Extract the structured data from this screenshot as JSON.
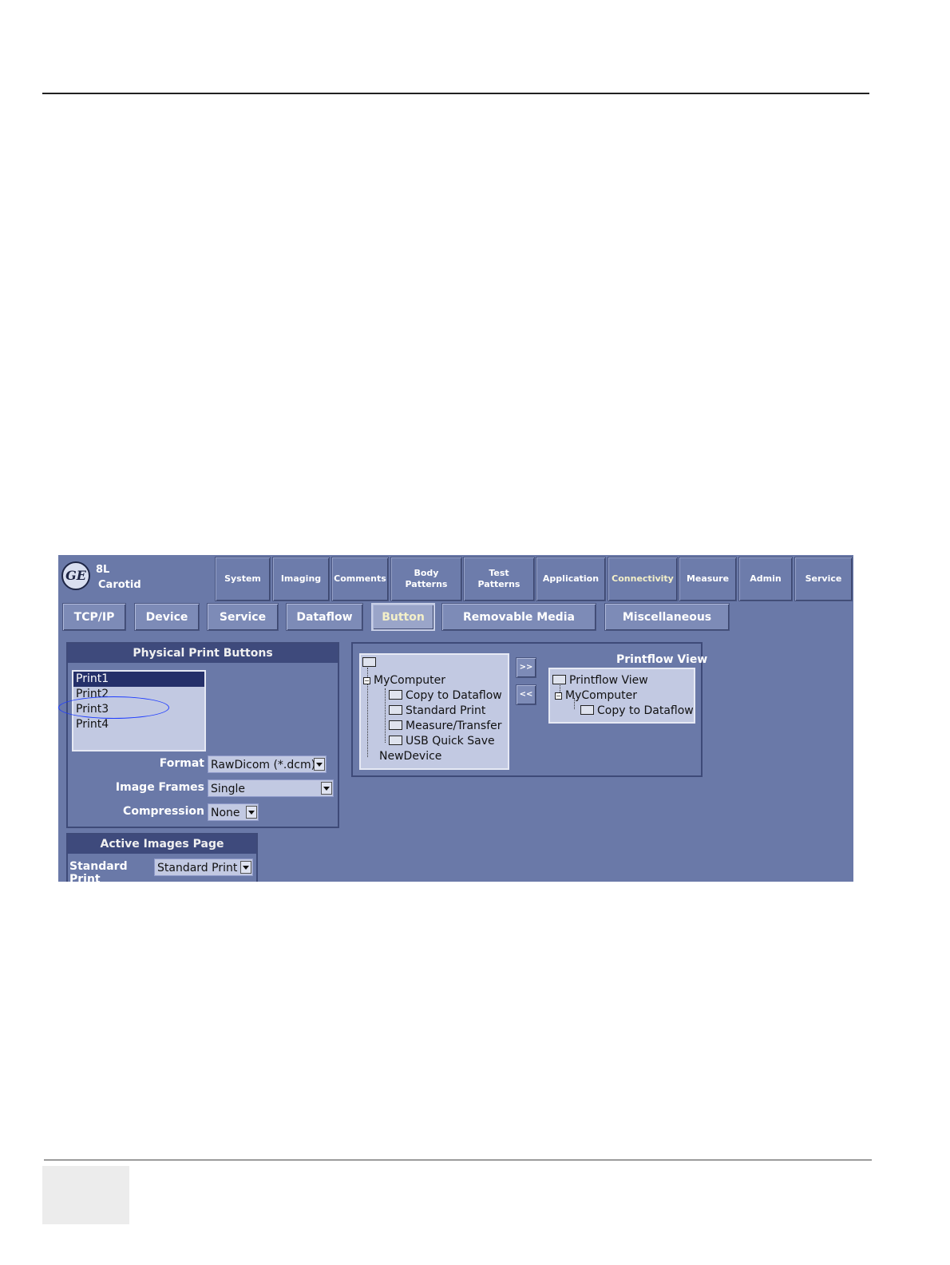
{
  "header": {
    "probe": "8L",
    "preset": "Carotid",
    "logo": "GE monogram"
  },
  "main_tabs": [
    {
      "label": "System"
    },
    {
      "label": "Imaging"
    },
    {
      "label": "Comments"
    },
    {
      "label": "Body\nPatterns"
    },
    {
      "label": "Test\nPatterns"
    },
    {
      "label": "Application"
    },
    {
      "label": "Connectivity",
      "active": true
    },
    {
      "label": "Measure"
    },
    {
      "label": "Admin"
    },
    {
      "label": "Service"
    }
  ],
  "sub_tabs": [
    {
      "label": "TCP/IP"
    },
    {
      "label": "Device"
    },
    {
      "label": "Service"
    },
    {
      "label": "Dataflow"
    },
    {
      "label": "Button",
      "active": true
    },
    {
      "label": "Removable Media"
    },
    {
      "label": "Miscellaneous"
    }
  ],
  "physical_print": {
    "title": "Physical Print Buttons",
    "items": [
      "Print1",
      "Print2",
      "Print3",
      "Print4"
    ],
    "selected": "Print1",
    "format_label": "Format",
    "format_value": "RawDicom (*.dcm)",
    "frames_label": "Image Frames",
    "frames_value": "Single",
    "compression_label": "Compression",
    "compression_value": "None"
  },
  "active_images": {
    "title": "Active Images Page",
    "label": "Standard Print",
    "value": "Standard Print"
  },
  "device_tree": {
    "root": "MyComputer",
    "children": [
      "Copy to Dataflow",
      "Standard Print",
      "Measure/Transfer",
      "USB Quick Save"
    ],
    "extra": "NewDevice"
  },
  "arrows": {
    "add": ">>",
    "remove": "<<"
  },
  "printflow": {
    "title": "Printflow View",
    "root": "Printflow View",
    "computer": "MyComputer",
    "child": "Copy to Dataflow"
  },
  "colors": {
    "background": "#6a79a8",
    "panel_title": "#3e4a7c",
    "list_bg": "#c2c9e2",
    "annotation": "#1e3cff"
  }
}
